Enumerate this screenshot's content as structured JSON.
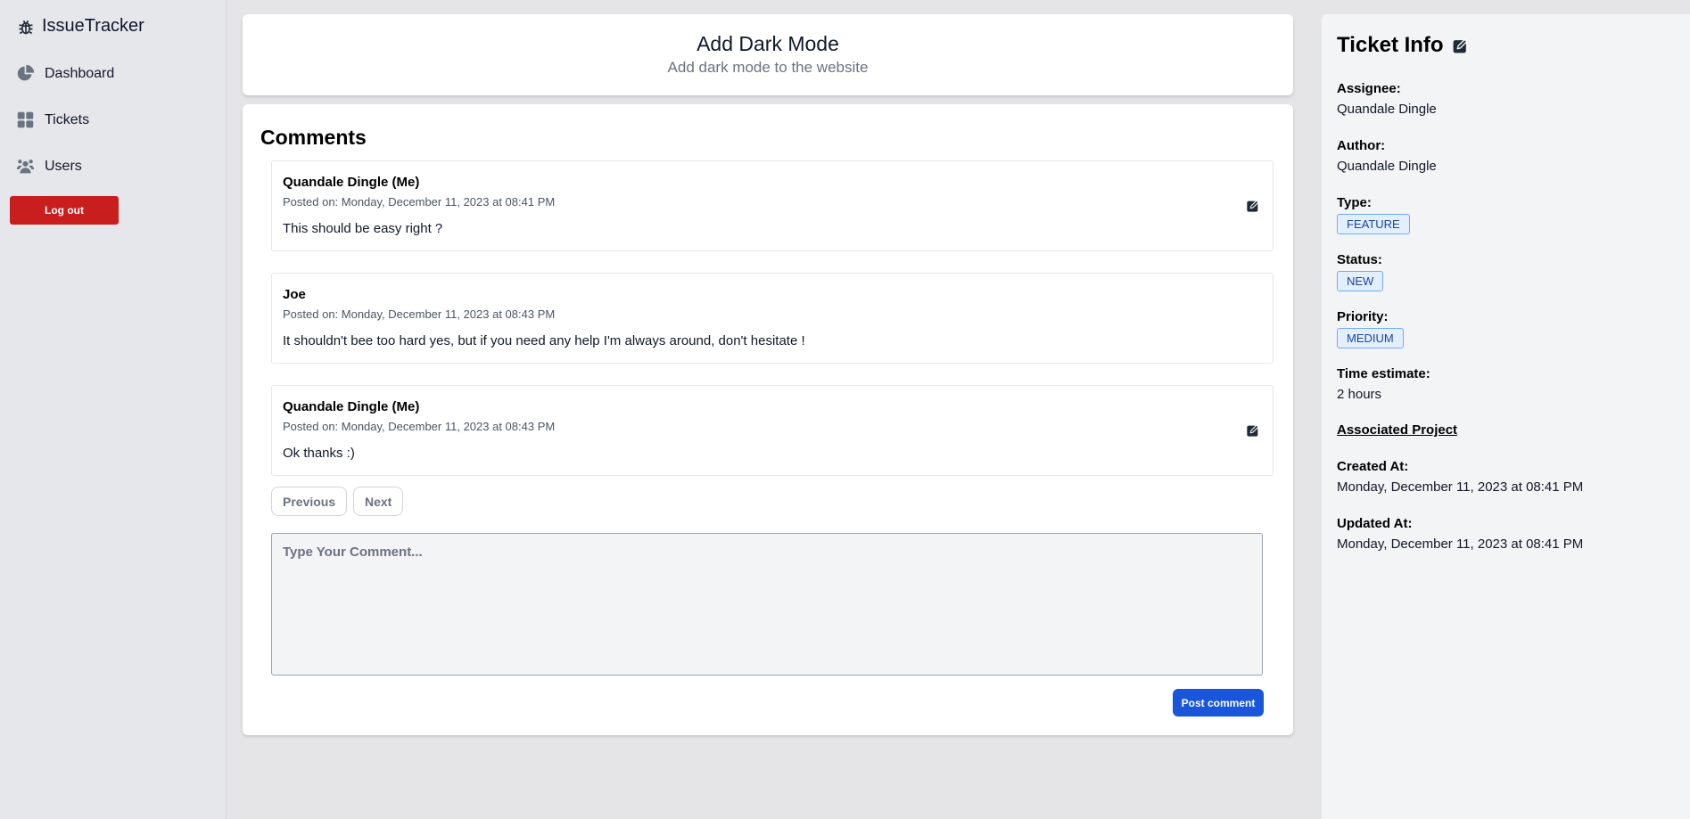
{
  "app": {
    "brand": "IssueTracker"
  },
  "sidebar": {
    "items": [
      {
        "label": "Dashboard",
        "icon": "pie-chart-icon"
      },
      {
        "label": "Tickets",
        "icon": "grid-icon"
      },
      {
        "label": "Users",
        "icon": "users-icon"
      }
    ],
    "logout_label": "Log out"
  },
  "ticket": {
    "title": "Add Dark Mode",
    "description": "Add dark mode to the website"
  },
  "comments": {
    "heading": "Comments",
    "items": [
      {
        "author": "Quandale Dingle (Me)",
        "date": "Posted on: Monday, December 11, 2023 at 08:41 PM",
        "body": "This should be easy right ?",
        "editable": true
      },
      {
        "author": "Joe",
        "date": "Posted on: Monday, December 11, 2023 at 08:43 PM",
        "body": "It shouldn't bee too hard yes, but if you need any help I'm always around, don't hesitate !",
        "editable": false
      },
      {
        "author": "Quandale Dingle (Me)",
        "date": "Posted on: Monday, December 11, 2023 at 08:43 PM",
        "body": "Ok thanks :)",
        "editable": true
      }
    ],
    "previous_label": "Previous",
    "next_label": "Next",
    "input_placeholder": "Type Your Comment...",
    "input_value": "",
    "post_label": "Post comment"
  },
  "info": {
    "title": "Ticket Info",
    "assignee_label": "Assignee:",
    "assignee": "Quandale Dingle",
    "author_label": "Author:",
    "author": "Quandale Dingle",
    "type_label": "Type:",
    "type": "FEATURE",
    "status_label": "Status:",
    "status": "NEW",
    "priority_label": "Priority:",
    "priority": "MEDIUM",
    "time_label": "Time estimate:",
    "time": "2 hours",
    "associated_project": "Associated Project",
    "created_label": "Created At:",
    "created": "Monday, December 11, 2023 at 08:41 PM",
    "updated_label": "Updated At:",
    "updated": "Monday, December 11, 2023 at 08:41 PM"
  },
  "colors": {
    "danger": "#c81e1e",
    "primary": "#1a56db",
    "badge_bg": "#e1effe",
    "badge_text": "#1e429f"
  }
}
